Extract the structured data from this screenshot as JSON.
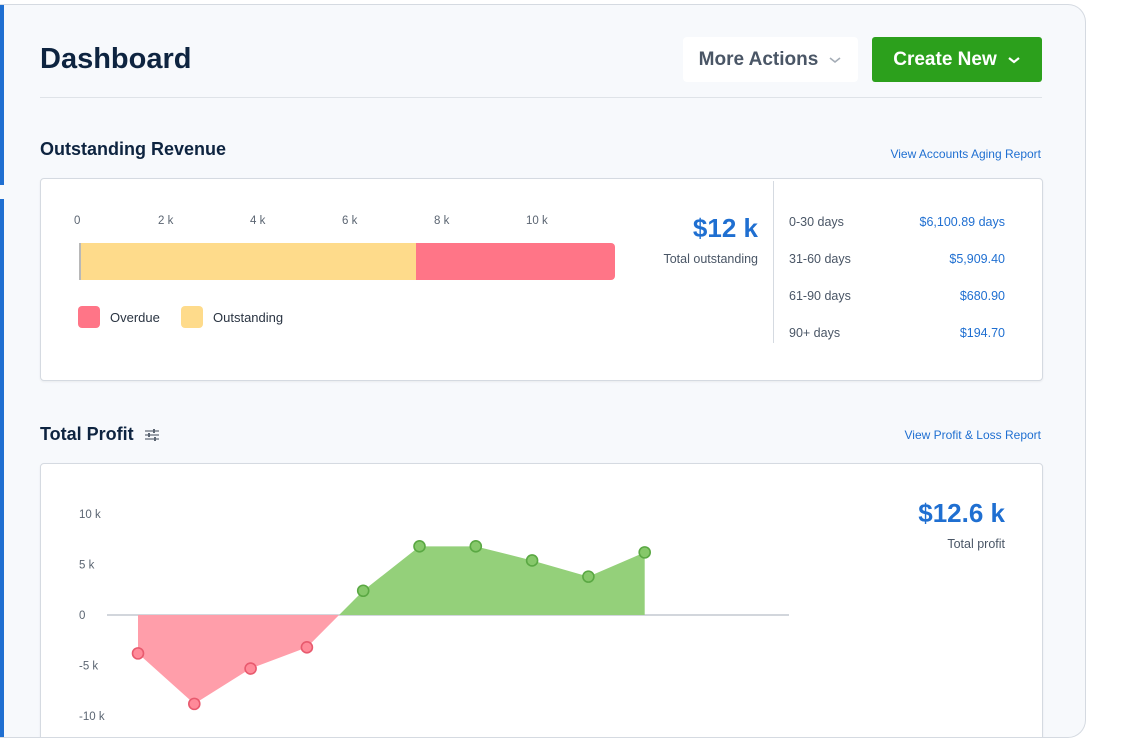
{
  "header": {
    "title": "Dashboard",
    "more_actions_label": "More Actions",
    "create_new_label": "Create New"
  },
  "outstanding": {
    "title": "Outstanding Revenue",
    "link": "View Accounts Aging Report",
    "axis_ticks": [
      "0",
      "2 k",
      "4 k",
      "6 k",
      "8 k",
      "10 k"
    ],
    "total_value": "$12 k",
    "total_label": "Total outstanding",
    "legend": [
      "Overdue",
      "Outstanding"
    ],
    "aging": [
      {
        "label": "0-30 days",
        "value": "$6,100.89 days"
      },
      {
        "label": "31-60 days",
        "value": "$5,909.40"
      },
      {
        "label": "61-90 days",
        "value": "$680.90"
      },
      {
        "label": "90+ days",
        "value": "$194.70"
      }
    ]
  },
  "profit": {
    "title": "Total Profit",
    "link": "View Profit & Loss Report",
    "total_value": "$12.6 k",
    "total_label": "Total profit"
  },
  "colors": {
    "accent": "#1f6fd1",
    "create_button": "#2ca01c",
    "overdue": "#ff7587",
    "outstanding": "#fedb8b",
    "profit_positive": "#94d07a",
    "profit_negative": "#ff9eaa"
  },
  "chart_data": [
    {
      "type": "bar",
      "orientation": "horizontal",
      "stacked": true,
      "categories": [
        "Outstanding Revenue"
      ],
      "series": [
        {
          "name": "Outstanding",
          "values": [
            7300
          ]
        },
        {
          "name": "Overdue",
          "values": [
            4300
          ]
        }
      ],
      "xlim": [
        0,
        11600
      ],
      "xticks": [
        "0",
        "2 k",
        "4 k",
        "6 k",
        "8 k",
        "10 k"
      ],
      "legend": "bottom-left"
    },
    {
      "type": "area",
      "x": [
        1,
        2,
        3,
        4,
        5,
        6,
        7,
        8,
        9,
        10
      ],
      "values": [
        -3.8,
        -8.8,
        -5.3,
        -3.2,
        2.4,
        6.8,
        6.8,
        5.4,
        3.8,
        6.2
      ],
      "y_unit": "k",
      "yticks": [
        "10 k",
        "5 k",
        "0",
        "-5 k",
        "-10 k"
      ],
      "ylim": [
        -10,
        10
      ],
      "grid": false
    }
  ]
}
